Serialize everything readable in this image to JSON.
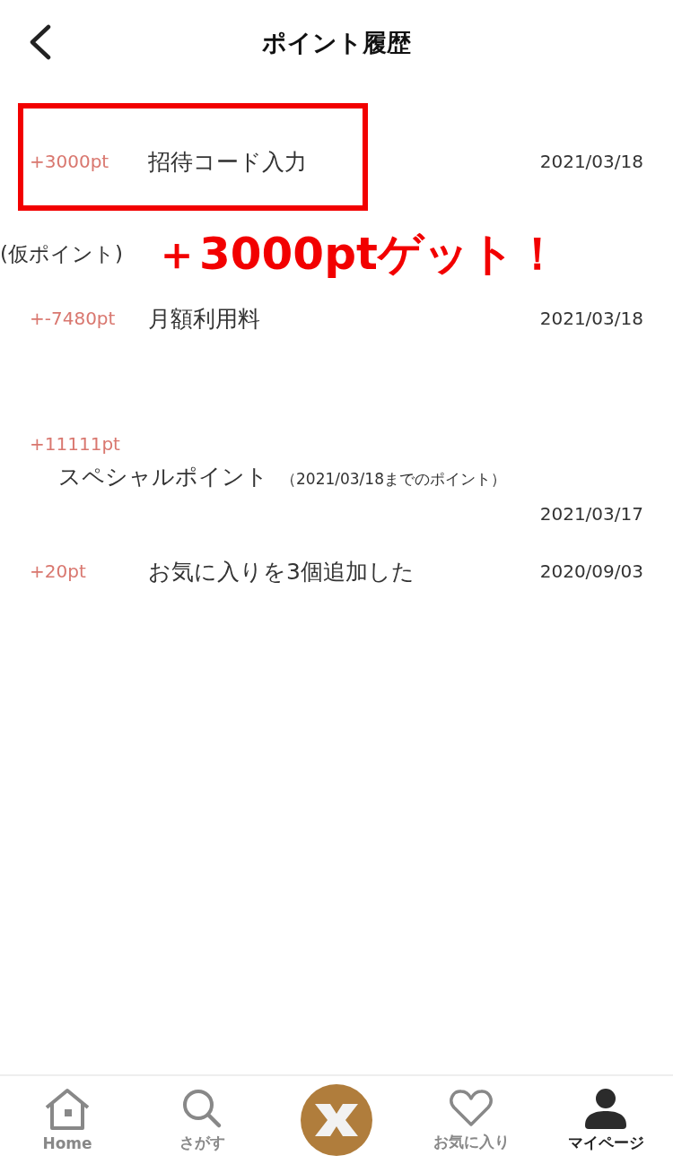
{
  "header": {
    "title": "ポイント履歴"
  },
  "entries": [
    {
      "kind": "inline",
      "amount": "+3000pt",
      "title": "招待コード入力",
      "date": "2021/03/18",
      "highlighted": true
    },
    {
      "kind": "inline",
      "amount": "+-7480pt",
      "title": "月額利用料",
      "date": "2021/03/18",
      "highlighted": false
    },
    {
      "kind": "stacked",
      "amount": "+11111pt",
      "title": "スペシャルポイント",
      "note": "（2021/03/18までのポイント）",
      "date": "2021/03/17",
      "highlighted": false
    },
    {
      "kind": "inline",
      "amount": "+20pt",
      "title": "お気に入りを3個追加した",
      "date": "2020/09/03",
      "highlighted": false
    }
  ],
  "annotation": {
    "label": "(仮ポイント)",
    "text": "＋3000ptゲット！"
  },
  "tab_bar": [
    {
      "kind": "home",
      "label": "Home",
      "selected": false
    },
    {
      "kind": "search",
      "label": "さがす",
      "selected": false
    },
    {
      "kind": "logo"
    },
    {
      "kind": "heart",
      "label": "お気に入り",
      "selected": false
    },
    {
      "kind": "person",
      "label": "マイページ",
      "selected": true
    }
  ]
}
